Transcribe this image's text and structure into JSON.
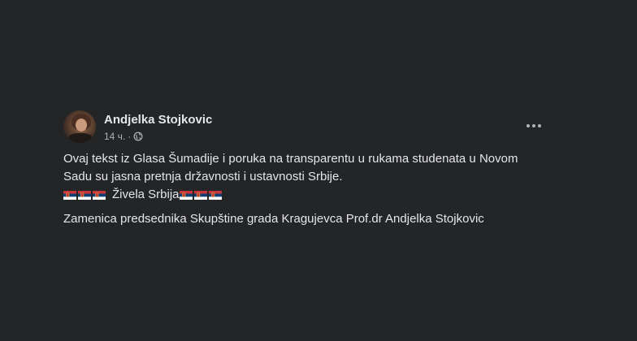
{
  "post": {
    "author": "Andjelka Stojkovic",
    "time": "14 ч.",
    "separator": "·",
    "privacy_icon": "globe-icon",
    "menu_icon": "more-options-icon",
    "body": {
      "line1": "Ovaj tekst iz Glasa Šumadije i poruka na transparentu u rukama studenata u Novom",
      "line2": "Sadu su jasna pretnja državnosti i ustavnosti Srbije.",
      "line3_text": "Živela Srbija",
      "line3_flag_emoji": "serbia-flag-icon",
      "line3_flags_before": 3,
      "line3_flags_after": 3,
      "line4": "Zamenica predsednika Skupštine grada Kragujevca Prof.dr Andjelka Stojkovic"
    }
  },
  "colors": {
    "background": "#242526",
    "primary_text": "#e4e6eb",
    "secondary_text": "#b0b3b8",
    "flag_red": "#c6363c",
    "flag_blue": "#0c4076",
    "flag_white": "#ffffff"
  }
}
